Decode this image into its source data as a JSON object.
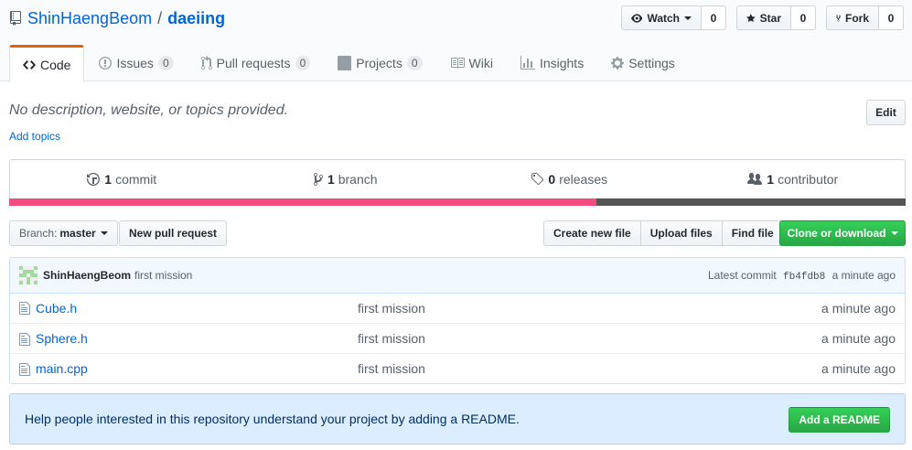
{
  "repo": {
    "owner": "ShinHaengBeom",
    "separator": "/",
    "name": "daeiing"
  },
  "actions": {
    "watch_label": "Watch",
    "watch_count": "0",
    "star_label": "Star",
    "star_count": "0",
    "fork_label": "Fork",
    "fork_count": "0"
  },
  "tabs": [
    {
      "label": "Code",
      "icon": "code-icon",
      "selected": true
    },
    {
      "label": "Issues",
      "icon": "issue-icon",
      "count": "0"
    },
    {
      "label": "Pull requests",
      "icon": "pull-request-icon",
      "count": "0"
    },
    {
      "label": "Projects",
      "icon": "project-icon",
      "count": "0"
    },
    {
      "label": "Wiki",
      "icon": "book-icon"
    },
    {
      "label": "Insights",
      "icon": "graph-icon"
    },
    {
      "label": "Settings",
      "icon": "gear-icon"
    }
  ],
  "about": {
    "description": "No description, website, or topics provided.",
    "add_topics": "Add topics",
    "edit_label": "Edit"
  },
  "summary": {
    "commits_num": "1",
    "commits_label": "commit",
    "branches_num": "1",
    "branches_label": "branch",
    "releases_num": "0",
    "releases_label": "releases",
    "contributors_num": "1",
    "contributors_label": "contributor"
  },
  "language_bar": [
    {
      "color": "#f34b7d",
      "percent": 65.5
    },
    {
      "color": "#555555",
      "percent": 34.5
    }
  ],
  "toolbar": {
    "branch_prefix": "Branch:",
    "branch_name": "master",
    "new_pr": "New pull request",
    "create_file": "Create new file",
    "upload_files": "Upload files",
    "find_file": "Find file",
    "clone": "Clone or download"
  },
  "commit": {
    "author": "ShinHaengBeom",
    "message": "first mission",
    "latest_label": "Latest commit",
    "sha": "fb4fdb8",
    "age": "a minute ago"
  },
  "files": [
    {
      "name": "Cube.h",
      "message": "first mission",
      "age": "a minute ago"
    },
    {
      "name": "Sphere.h",
      "message": "first mission",
      "age": "a minute ago"
    },
    {
      "name": "main.cpp",
      "message": "first mission",
      "age": "a minute ago"
    }
  ],
  "readme": {
    "text": "Help people interested in this repository understand your project by adding a README.",
    "button": "Add a README"
  }
}
